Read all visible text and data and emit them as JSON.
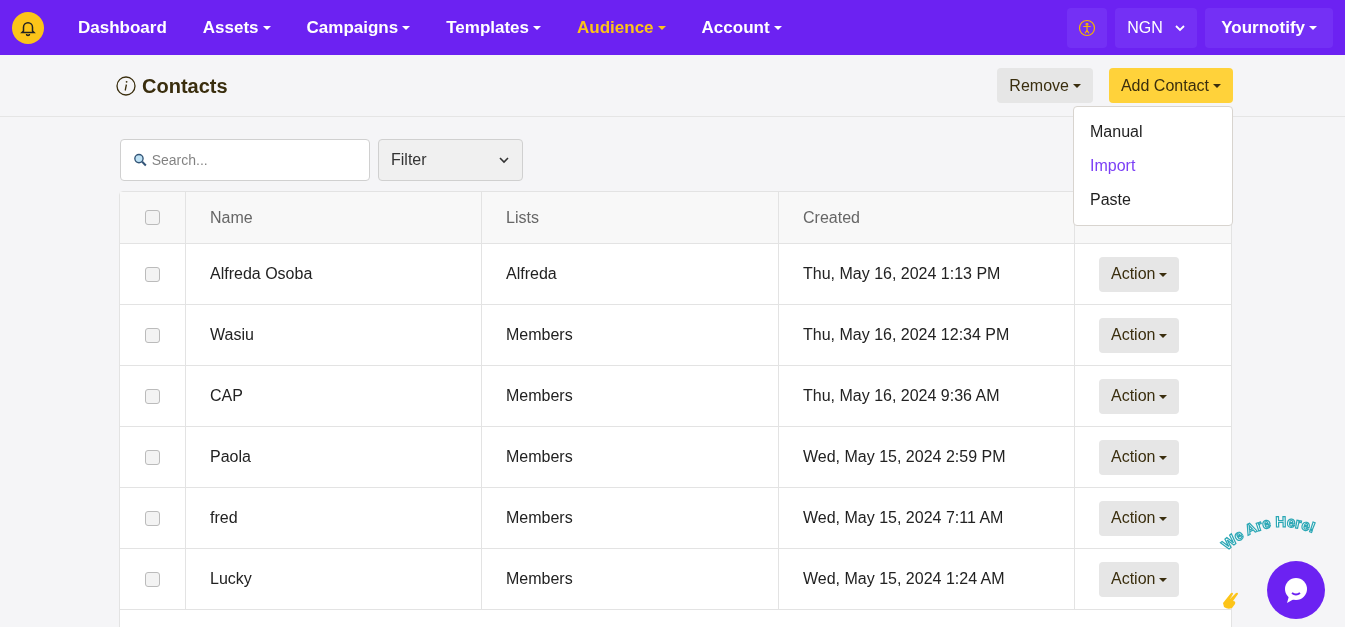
{
  "nav": {
    "items": [
      {
        "label": "Dashboard",
        "dropdown": false,
        "selected": false
      },
      {
        "label": "Assets",
        "dropdown": true,
        "selected": false
      },
      {
        "label": "Campaigns",
        "dropdown": true,
        "selected": false
      },
      {
        "label": "Templates",
        "dropdown": true,
        "selected": false
      },
      {
        "label": "Audience",
        "dropdown": true,
        "selected": true
      },
      {
        "label": "Account",
        "dropdown": true,
        "selected": false
      }
    ],
    "currency": "NGN",
    "user": "Yournotify"
  },
  "page": {
    "title": "Contacts",
    "remove_button": "Remove",
    "add_button": "Add Contact",
    "add_menu": [
      {
        "label": "Manual",
        "selected": false
      },
      {
        "label": "Import",
        "selected": true
      },
      {
        "label": "Paste",
        "selected": false
      }
    ]
  },
  "search": {
    "placeholder": "Search..."
  },
  "filter": {
    "value": "Filter"
  },
  "table": {
    "select_all_checked": false,
    "columns": [
      "Name",
      "Lists",
      "Created"
    ],
    "rows": [
      {
        "checked": false,
        "name": "Alfreda Osoba",
        "list": "Alfreda",
        "created": "Thu, May 16, 2024 1:13 PM",
        "action": "Action"
      },
      {
        "checked": false,
        "name": "Wasiu",
        "list": "Members",
        "created": "Thu, May 16, 2024 12:34 PM",
        "action": "Action"
      },
      {
        "checked": false,
        "name": "CAP",
        "list": "Members",
        "created": "Thu, May 16, 2024 9:36 AM",
        "action": "Action"
      },
      {
        "checked": false,
        "name": "Paola",
        "list": "Members",
        "created": "Wed, May 15, 2024 2:59 PM",
        "action": "Action"
      },
      {
        "checked": false,
        "name": "fred",
        "list": "Members",
        "created": "Wed, May 15, 2024 7:11 AM",
        "action": "Action"
      },
      {
        "checked": false,
        "name": "Lucky",
        "list": "Members",
        "created": "Wed, May 15, 2024 1:24 AM",
        "action": "Action"
      }
    ]
  },
  "chat_widget": {
    "label": "We Are Here!"
  }
}
